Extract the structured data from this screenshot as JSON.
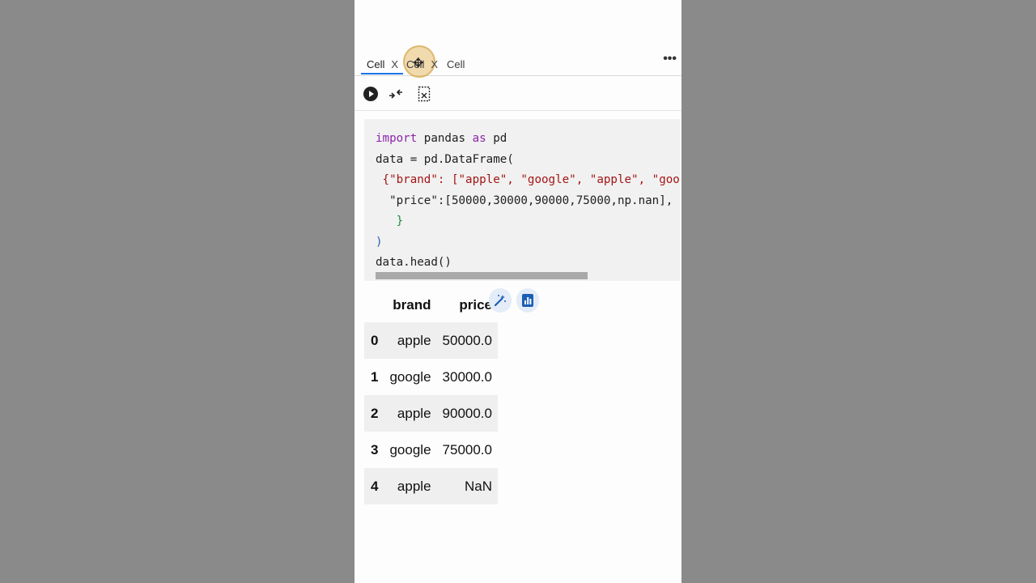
{
  "tabs": [
    {
      "label": "Cell",
      "close": "X"
    },
    {
      "label": "Cell",
      "close": "X"
    },
    {
      "label": "Cell"
    }
  ],
  "menu_more": "•••",
  "toolbar": {
    "run": "run-cell",
    "collapse": "collapse-arrows",
    "clear": "clear-output"
  },
  "code_lines": [
    [
      "import",
      " pandas ",
      "as",
      " pd"
    ],
    [
      "data = pd.DataFrame("
    ],
    [
      "{\"brand\": [\"apple\", \"google\", \"apple\", \"google"
    ],
    [
      "\"price\":[50000,30000,90000,75000,np.nan],"
    ],
    [
      "}"
    ],
    [
      ")"
    ],
    [
      "data.head()"
    ]
  ],
  "output": {
    "columns": [
      "",
      "brand",
      "price"
    ],
    "rows": [
      [
        "0",
        "apple",
        "50000.0"
      ],
      [
        "1",
        "google",
        "30000.0"
      ],
      [
        "2",
        "apple",
        "90000.0"
      ],
      [
        "3",
        "google",
        "75000.0"
      ],
      [
        "4",
        "apple",
        "NaN"
      ]
    ]
  },
  "icons": {
    "magic": "magic-wand-icon",
    "chart": "chart-icon"
  },
  "colors": {
    "keyword": "#8e24aa",
    "string": "#a31515",
    "number": "#116644",
    "accent": "#1a73e8"
  }
}
